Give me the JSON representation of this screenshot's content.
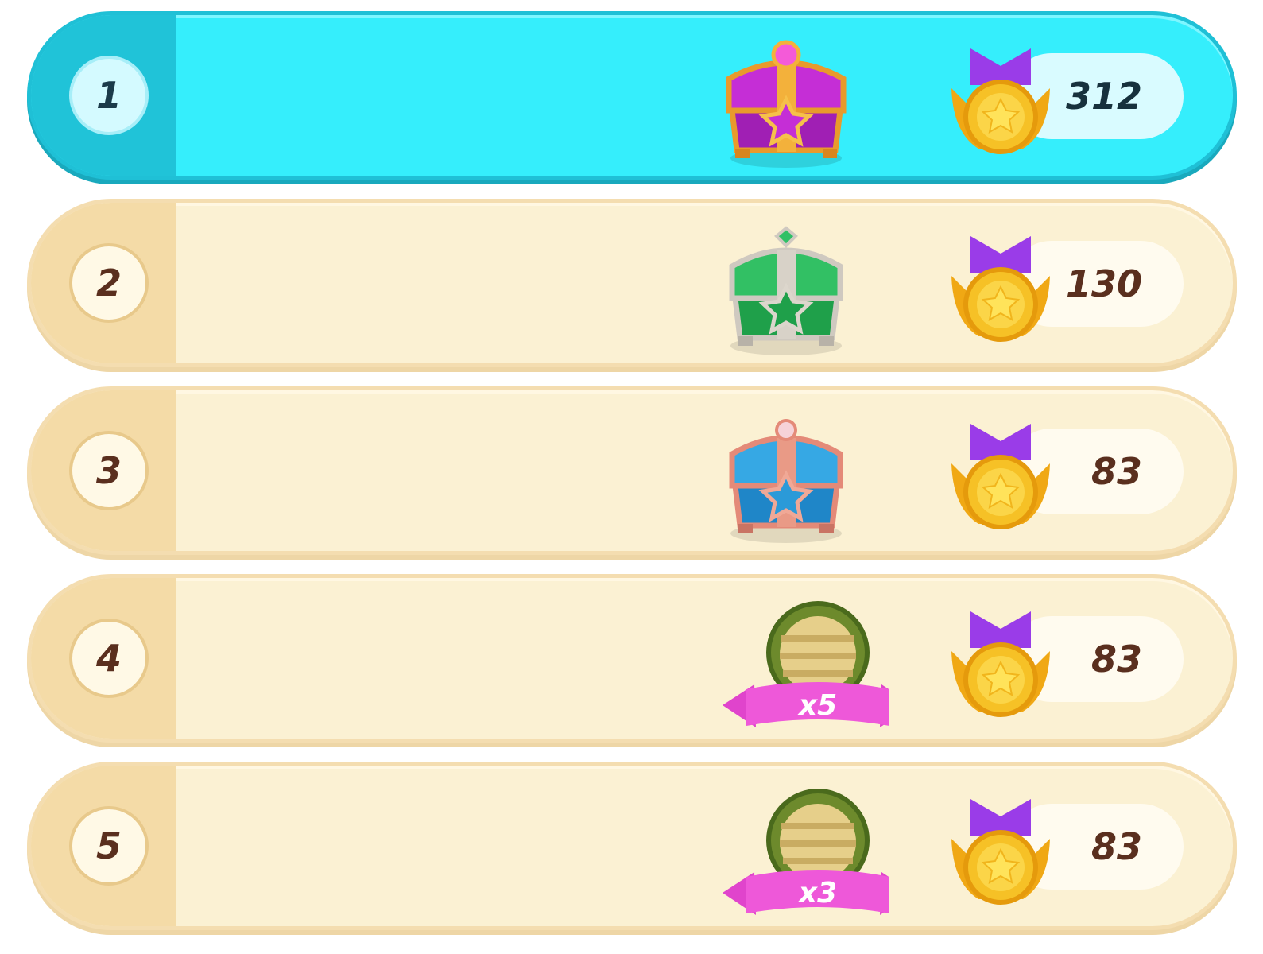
{
  "leaderboard": {
    "rows": [
      {
        "rank": "1",
        "score": "312",
        "reward": {
          "icon": "purple-treasure-chest-icon",
          "quantity": ""
        },
        "highlighted": true
      },
      {
        "rank": "2",
        "score": "130",
        "reward": {
          "icon": "green-treasure-chest-icon",
          "quantity": ""
        },
        "highlighted": false
      },
      {
        "rank": "3",
        "score": "83",
        "reward": {
          "icon": "blue-treasure-chest-icon",
          "quantity": ""
        },
        "highlighted": false
      },
      {
        "rank": "4",
        "score": "83",
        "reward": {
          "icon": "wooden-barrel-icon",
          "quantity": "x5"
        },
        "highlighted": false
      },
      {
        "rank": "5",
        "score": "83",
        "reward": {
          "icon": "wooden-barrel-icon",
          "quantity": "x3"
        },
        "highlighted": false
      }
    ]
  },
  "icons": {
    "score": "gold-star-medal-icon"
  },
  "colors": {
    "highlight_row": "#35eefc",
    "normal_row": "#fbf1d3",
    "rank_strip": "#f4dba7",
    "text_brown": "#5a2f1e",
    "ribbon_pink": "#e54ad4",
    "medal_ribbon": "#9a3ce8",
    "medal_gold": "#f3b61c"
  }
}
